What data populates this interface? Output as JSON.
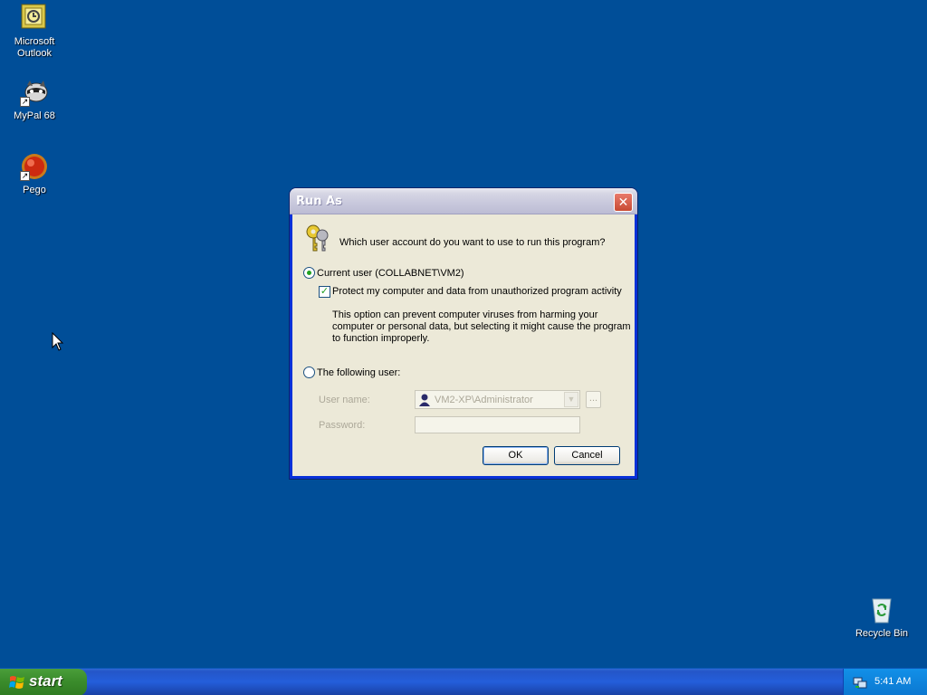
{
  "desktop": {
    "icons": [
      {
        "label_line1": "Microsoft",
        "label_line2": "Outlook"
      },
      {
        "label_line1": "MyPal 68",
        "label_line2": ""
      },
      {
        "label_line1": "Pego",
        "label_line2": ""
      },
      {
        "label_line1": "Recycle Bin",
        "label_line2": ""
      }
    ]
  },
  "dialog": {
    "title": "Run As",
    "close_symbol": "✕",
    "question": "Which user account do you want to use to run this program?",
    "current_user_label": "Current user (COLLABNET\\VM2)",
    "protect_label": "Protect my computer and data from unauthorized program activity",
    "protect_desc_line1": "This option can prevent computer viruses from harming your",
    "protect_desc_line2": "computer or personal data, but selecting it might cause the program",
    "protect_desc_line3": "to function improperly.",
    "following_user_label": "The following user:",
    "username_label": "User name:",
    "username_value": "VM2-XP\\Administrator",
    "browse_label": "...",
    "password_label": "Password:",
    "password_value": "",
    "ok_label": "OK",
    "cancel_label": "Cancel",
    "current_user_selected": true,
    "protect_checked": true
  },
  "taskbar": {
    "start_label": "start",
    "clock": "5:41 AM"
  },
  "colors": {
    "desktop": "#004e98",
    "dialog_bg": "#ece9d8",
    "taskbar": "#245edb",
    "start_green": "#3c8e2d"
  },
  "icons": [
    "outlook-icon",
    "mypal-icon",
    "pego-icon",
    "recycle-bin-icon",
    "key-icon",
    "user-icon",
    "windows-flag-icon",
    "tray-network-icon",
    "mouse-cursor-icon"
  ]
}
